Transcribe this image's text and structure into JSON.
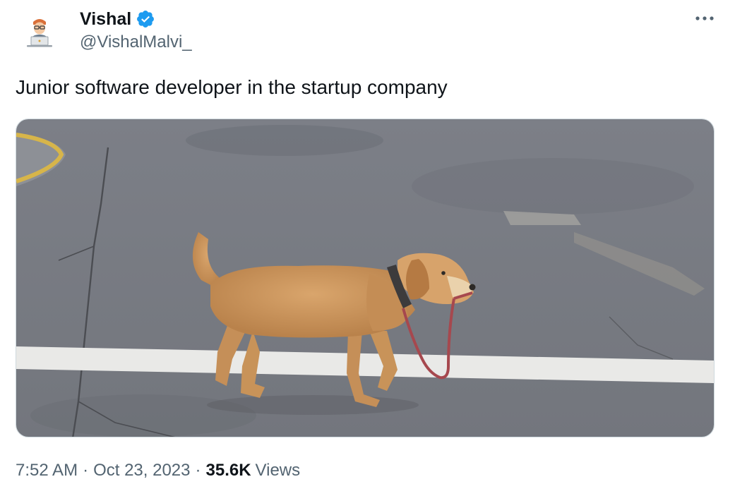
{
  "tweet": {
    "author": {
      "display_name": "Vishal",
      "handle": "@VishalMalvi_",
      "verified_icon": "verified-badge-icon",
      "avatar_icon": "developer-at-laptop-avatar"
    },
    "more_icon": "more-horizontal-icon",
    "text": "Junior software developer in the startup company",
    "media": {
      "kind": "photo",
      "subject_icon": "dog-carrying-own-leash-photo"
    },
    "meta": {
      "time": "7:52 AM",
      "separator": "·",
      "date": "Oct 23, 2023",
      "views_count": "35.6K",
      "views_label": "Views"
    },
    "colors": {
      "text_primary": "#0f1419",
      "text_secondary": "#536471",
      "verified_blue": "#1d9bf0",
      "border": "#cfd9de"
    }
  }
}
